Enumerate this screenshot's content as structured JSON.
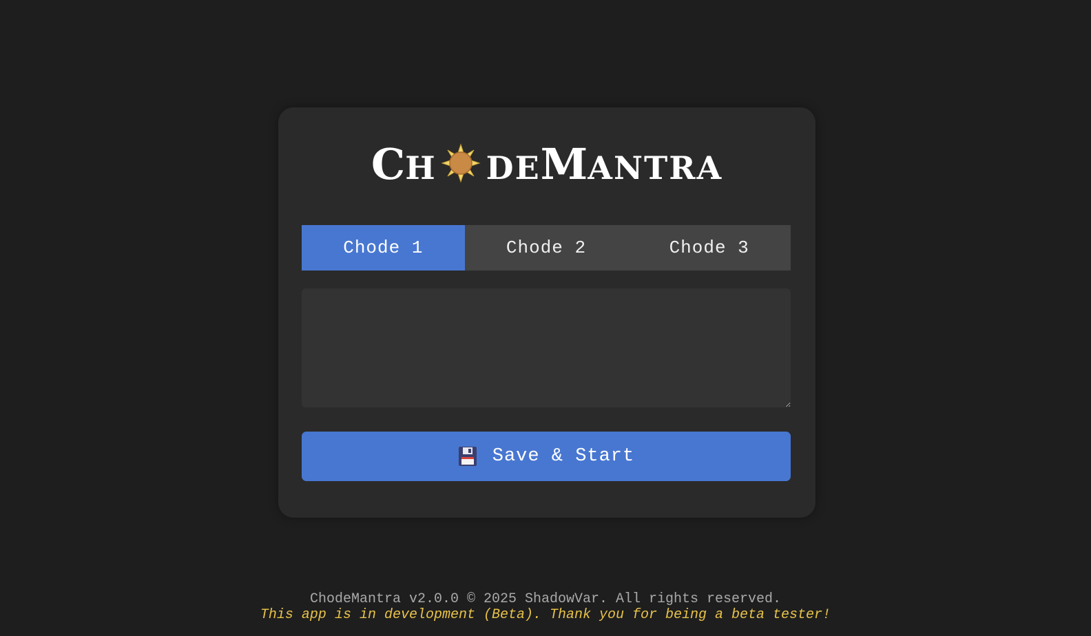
{
  "logo": {
    "part1_big": "C",
    "part1_small": "H",
    "sun_icon": "sun-icon",
    "part2_small": "DE",
    "part3_big": "M",
    "part3_small": "ANTRA"
  },
  "tabs": [
    {
      "label": "Chode 1",
      "active": true
    },
    {
      "label": "Chode 2",
      "active": false
    },
    {
      "label": "Chode 3",
      "active": false
    }
  ],
  "editor": {
    "value": "",
    "placeholder": ""
  },
  "save_button": {
    "icon": "floppy-disk-icon",
    "label": "Save & Start"
  },
  "footer": {
    "copyright": "ChodeMantra v2.0.0 © 2025 ShadowVar. All rights reserved.",
    "beta_notice": "This app is in development (Beta). Thank you for being a beta tester!"
  },
  "colors": {
    "background": "#1e1e1e",
    "card": "#2a2a2a",
    "accent": "#4877d1",
    "tab_inactive": "#444444",
    "beta_text": "#e8c24a"
  }
}
